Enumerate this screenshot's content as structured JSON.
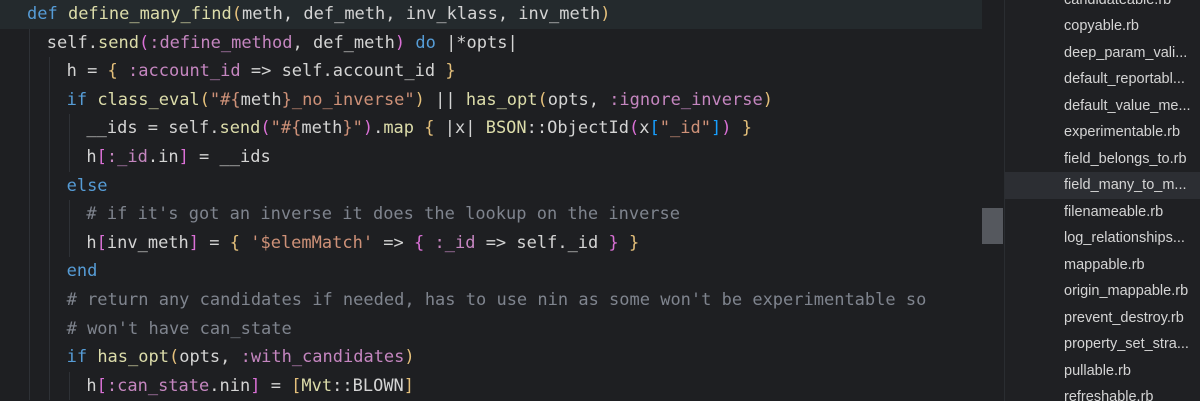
{
  "editor": {
    "lines": [
      [
        {
          "t": "def ",
          "c": "kw"
        },
        {
          "t": "define_many_find",
          "c": "fn"
        },
        {
          "t": "(",
          "c": "br"
        },
        {
          "t": "meth, def_meth, inv_klass, inv_meth",
          "c": "id"
        },
        {
          "t": ")",
          "c": "br"
        }
      ],
      [
        {
          "t": "self",
          "c": "id"
        },
        {
          "t": ".",
          "c": "id"
        },
        {
          "t": "send",
          "c": "fn"
        },
        {
          "t": "(",
          "c": "br2"
        },
        {
          "t": ":define_method",
          "c": "sym"
        },
        {
          "t": ", def_meth",
          "c": "id"
        },
        {
          "t": ")",
          "c": "br2"
        },
        {
          "t": " do ",
          "c": "kw"
        },
        {
          "t": "|*opts|",
          "c": "id"
        }
      ],
      [
        {
          "t": "h = ",
          "c": "id"
        },
        {
          "t": "{",
          "c": "br"
        },
        {
          "t": " :account_id",
          "c": "sym"
        },
        {
          "t": " => self.account_id ",
          "c": "id"
        },
        {
          "t": "}",
          "c": "br"
        }
      ],
      [
        {
          "t": "if ",
          "c": "kw"
        },
        {
          "t": "class_eval",
          "c": "fn"
        },
        {
          "t": "(",
          "c": "br"
        },
        {
          "t": "\"#{",
          "c": "str"
        },
        {
          "t": "meth",
          "c": "id"
        },
        {
          "t": "}_no_inverse\"",
          "c": "str"
        },
        {
          "t": ")",
          "c": "br"
        },
        {
          "t": " || ",
          "c": "id"
        },
        {
          "t": "has_opt",
          "c": "fn"
        },
        {
          "t": "(",
          "c": "br"
        },
        {
          "t": "opts, ",
          "c": "id"
        },
        {
          "t": ":ignore_inverse",
          "c": "sym"
        },
        {
          "t": ")",
          "c": "br"
        }
      ],
      [
        {
          "t": "__ids = self.",
          "c": "id"
        },
        {
          "t": "send",
          "c": "fn"
        },
        {
          "t": "(",
          "c": "br2"
        },
        {
          "t": "\"#{",
          "c": "str"
        },
        {
          "t": "meth",
          "c": "id"
        },
        {
          "t": "}\"",
          "c": "str"
        },
        {
          "t": ")",
          "c": "br2"
        },
        {
          "t": ".",
          "c": "id"
        },
        {
          "t": "map",
          "c": "fn"
        },
        {
          "t": " { ",
          "c": "br"
        },
        {
          "t": "|x| ",
          "c": "id"
        },
        {
          "t": "BSON",
          "c": "cls"
        },
        {
          "t": "::ObjectId",
          "c": "id"
        },
        {
          "t": "(",
          "c": "br2"
        },
        {
          "t": "x",
          "c": "id"
        },
        {
          "t": "[",
          "c": "br3"
        },
        {
          "t": "\"_id\"",
          "c": "str"
        },
        {
          "t": "]",
          "c": "br3"
        },
        {
          "t": ")",
          "c": "br2"
        },
        {
          "t": " }",
          "c": "br"
        }
      ],
      [
        {
          "t": "h",
          "c": "id"
        },
        {
          "t": "[",
          "c": "br2"
        },
        {
          "t": ":_id",
          "c": "sym"
        },
        {
          "t": ".in",
          "c": "id"
        },
        {
          "t": "]",
          "c": "br2"
        },
        {
          "t": " = __ids",
          "c": "id"
        }
      ],
      [
        {
          "t": "else",
          "c": "kw"
        }
      ],
      [
        {
          "t": "# if it's got an inverse it does the lookup on the inverse",
          "c": "cm"
        }
      ],
      [
        {
          "t": "h",
          "c": "id"
        },
        {
          "t": "[",
          "c": "br2"
        },
        {
          "t": "inv_meth",
          "c": "id"
        },
        {
          "t": "]",
          "c": "br2"
        },
        {
          "t": " = ",
          "c": "id"
        },
        {
          "t": "{",
          "c": "br"
        },
        {
          "t": " '$elemMatch'",
          "c": "str"
        },
        {
          "t": " => ",
          "c": "id"
        },
        {
          "t": "{",
          "c": "br2"
        },
        {
          "t": " :_id",
          "c": "sym"
        },
        {
          "t": " => self._id ",
          "c": "id"
        },
        {
          "t": "}",
          "c": "br2"
        },
        {
          "t": " }",
          "c": "br"
        }
      ],
      [
        {
          "t": "end",
          "c": "kw"
        }
      ],
      [
        {
          "t": "# return any candidates if needed, has to use nin as some won't be experimentable so",
          "c": "cm"
        }
      ],
      [
        {
          "t": "# won't have can_state",
          "c": "cm"
        }
      ],
      [
        {
          "t": "if ",
          "c": "kw"
        },
        {
          "t": "has_opt",
          "c": "fn"
        },
        {
          "t": "(",
          "c": "br"
        },
        {
          "t": "opts, ",
          "c": "id"
        },
        {
          "t": ":with_candidates",
          "c": "sym"
        },
        {
          "t": ")",
          "c": "br"
        }
      ],
      [
        {
          "t": "h",
          "c": "id"
        },
        {
          "t": "[",
          "c": "br2"
        },
        {
          "t": ":can_state",
          "c": "sym"
        },
        {
          "t": ".nin",
          "c": "id"
        },
        {
          "t": "]",
          "c": "br2"
        },
        {
          "t": " = ",
          "c": "id"
        },
        {
          "t": "[",
          "c": "br"
        },
        {
          "t": "Mvt",
          "c": "cls"
        },
        {
          "t": "::BLOWN",
          "c": "id"
        },
        {
          "t": "]",
          "c": "br"
        }
      ]
    ]
  },
  "explorer": {
    "files": [
      "candidateable.rb",
      "copyable.rb",
      "deep_param_vali...",
      "default_reportabl...",
      "default_value_me...",
      "experimentable.rb",
      "field_belongs_to.rb",
      "field_many_to_m...",
      "filenameable.rb",
      "log_relationships...",
      "mappable.rb",
      "origin_mappable.rb",
      "prevent_destroy.rb",
      "property_set_stra...",
      "pullable.rb",
      "refreshable.rb"
    ],
    "selected_index": 7
  },
  "colors": {
    "editor_bg": "#1e1f22",
    "keyword": "#569cd6",
    "function": "#dcdcaa",
    "symbol": "#c586c0",
    "string": "#ce9178",
    "comment": "#7f848e",
    "text": "#d4d4d4"
  }
}
